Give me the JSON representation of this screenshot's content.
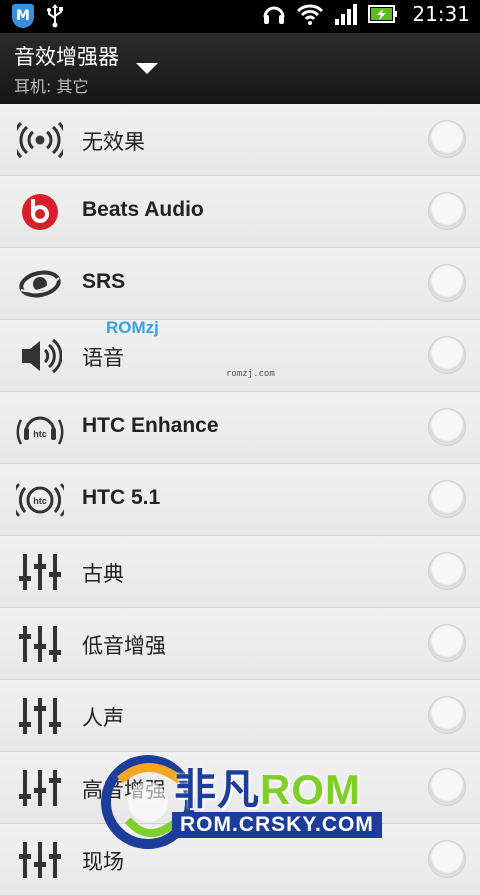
{
  "status_bar": {
    "time": "21:31",
    "left_icons": [
      "shield-icon",
      "usb-icon"
    ],
    "right_icons": [
      "headset-icon",
      "wifi-icon",
      "signal-icon",
      "battery-charging-icon"
    ],
    "shield_letter": "M"
  },
  "header": {
    "title": "音效增强器",
    "subtitle": "耳机: 其它"
  },
  "items": [
    {
      "label": "无效果",
      "icon": "no-effect-icon",
      "bold": false
    },
    {
      "label": "Beats Audio",
      "icon": "beats-icon",
      "bold": true
    },
    {
      "label": "SRS",
      "icon": "srs-icon",
      "bold": true
    },
    {
      "label": "语音",
      "icon": "speaker-icon",
      "bold": false
    },
    {
      "label": "HTC Enhance",
      "icon": "htc-headphone-icon",
      "bold": true
    },
    {
      "label": "HTC 5.1",
      "icon": "htc-surround-icon",
      "bold": true
    },
    {
      "label": "古典",
      "icon": "equalizer-icon",
      "bold": false
    },
    {
      "label": "低音增强",
      "icon": "equalizer-icon",
      "bold": false
    },
    {
      "label": "人声",
      "icon": "equalizer-icon",
      "bold": false
    },
    {
      "label": "高音增强",
      "icon": "equalizer-icon",
      "bold": false
    },
    {
      "label": "现场",
      "icon": "equalizer-icon",
      "bold": false
    }
  ],
  "watermark": {
    "top_logo": "ROMzj",
    "top_url": "romzj.com",
    "brand_a": "非凡",
    "brand_b": "ROM",
    "url": "ROM.CRSKY.COM"
  }
}
